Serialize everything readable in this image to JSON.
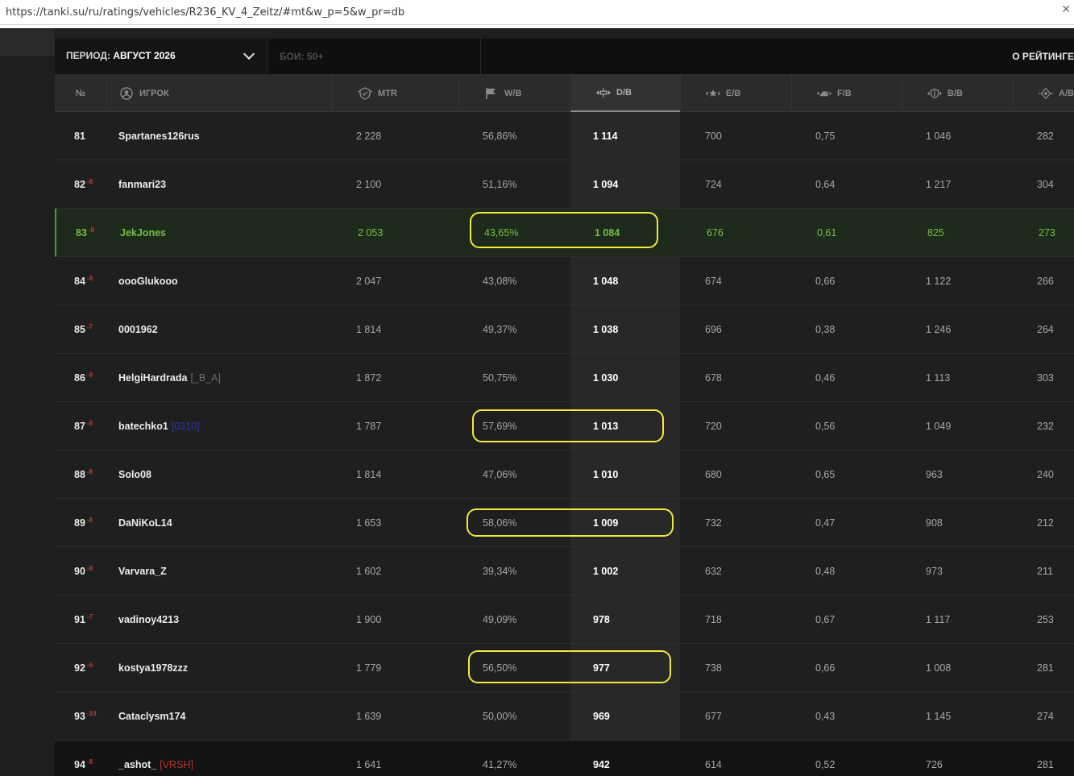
{
  "browser": {
    "url": "https://tanki.su/ru/ratings/vehicles/R236_KV_4_Zeitz/#mt&w_p=5&w_pr=db",
    "close_glyph": "✕"
  },
  "filters": {
    "period_label": "ПЕРИОД:",
    "period_value": "АВГУСТ 2026",
    "battles": "БОИ: 50+",
    "about": "О РЕЙТИНГЕ"
  },
  "columns": {
    "rank": "№",
    "player": "ИГРОК",
    "mtr": "MTR",
    "wb": "W/B",
    "db": "D/B",
    "eb": "E/B",
    "fb": "F/B",
    "bb": "B/B",
    "ab": "A/B"
  },
  "rows": [
    {
      "rank": "81",
      "delta": "",
      "player": "Spartanes126rus",
      "clan": "",
      "mtr": "2 228",
      "wb": "56,86%",
      "db": "1 114",
      "eb": "700",
      "fb": "0,75",
      "bb": "1 046",
      "ab": "282"
    },
    {
      "rank": "82",
      "delta": "-8",
      "player": "fanmari23",
      "clan": "",
      "mtr": "2 100",
      "wb": "51,16%",
      "db": "1 094",
      "eb": "724",
      "fb": "0,64",
      "bb": "1 217",
      "ab": "304"
    },
    {
      "rank": "83",
      "delta": "-8",
      "player": "JekJones",
      "clan": "",
      "mtr": "2 053",
      "wb": "43,65%",
      "db": "1 084",
      "eb": "676",
      "fb": "0,61",
      "bb": "825",
      "ab": "273"
    },
    {
      "rank": "84",
      "delta": "-8",
      "player": "oooGlukooo",
      "clan": "",
      "mtr": "2 047",
      "wb": "43,08%",
      "db": "1 048",
      "eb": "674",
      "fb": "0,66",
      "bb": "1 122",
      "ab": "266"
    },
    {
      "rank": "85",
      "delta": "-7",
      "player": "0001962",
      "clan": "",
      "mtr": "1 814",
      "wb": "49,37%",
      "db": "1 038",
      "eb": "696",
      "fb": "0,38",
      "bb": "1 246",
      "ab": "264"
    },
    {
      "rank": "86",
      "delta": "-9",
      "player": "HelgiHardrada",
      "clan": "[_B_A]",
      "mtr": "1 872",
      "wb": "50,75%",
      "db": "1 030",
      "eb": "678",
      "fb": "0,46",
      "bb": "1 113",
      "ab": "303"
    },
    {
      "rank": "87",
      "delta": "-8",
      "player": "batechko1",
      "clan": "[0310]",
      "mtr": "1 787",
      "wb": "57,69%",
      "db": "1 013",
      "eb": "720",
      "fb": "0,56",
      "bb": "1 049",
      "ab": "232"
    },
    {
      "rank": "88",
      "delta": "-8",
      "player": "Solo08",
      "clan": "",
      "mtr": "1 814",
      "wb": "47,06%",
      "db": "1 010",
      "eb": "680",
      "fb": "0,65",
      "bb": "963",
      "ab": "240"
    },
    {
      "rank": "89",
      "delta": "-8",
      "player": "DaNiKoL14",
      "clan": "",
      "mtr": "1 653",
      "wb": "58,06%",
      "db": "1 009",
      "eb": "732",
      "fb": "0,47",
      "bb": "908",
      "ab": "212"
    },
    {
      "rank": "90",
      "delta": "-8",
      "player": "Varvara_Z",
      "clan": "",
      "mtr": "1 602",
      "wb": "39,34%",
      "db": "1 002",
      "eb": "632",
      "fb": "0,48",
      "bb": "973",
      "ab": "211"
    },
    {
      "rank": "91",
      "delta": "-7",
      "player": "vadinoy4213",
      "clan": "",
      "mtr": "1 900",
      "wb": "49,09%",
      "db": "978",
      "eb": "718",
      "fb": "0,67",
      "bb": "1 117",
      "ab": "253"
    },
    {
      "rank": "92",
      "delta": "-6",
      "player": "kostya1978zzz",
      "clan": "",
      "mtr": "1 779",
      "wb": "56,50%",
      "db": "977",
      "eb": "738",
      "fb": "0,66",
      "bb": "1 008",
      "ab": "281"
    },
    {
      "rank": "93",
      "delta": "-10",
      "player": "Cataclysm174",
      "clan": "",
      "mtr": "1 639",
      "wb": "50,00%",
      "db": "969",
      "eb": "677",
      "fb": "0,43",
      "bb": "1 145",
      "ab": "274"
    },
    {
      "rank": "94",
      "delta": "-8",
      "player": "_ashot_",
      "clan": "[VRSH]",
      "mtr": "1 641",
      "wb": "41,27%",
      "db": "942",
      "eb": "614",
      "fb": "0,52",
      "bb": "726",
      "ab": "281"
    }
  ],
  "colors": {
    "highlight": "#f2e93a",
    "current_player": "#74c043",
    "delta_down": "#c0392b"
  }
}
